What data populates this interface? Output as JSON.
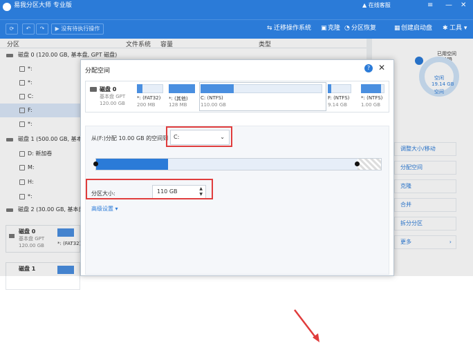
{
  "app": {
    "title": "易我分区大师 专业版",
    "service_label": "在线客服",
    "window_controls": {
      "menu": "≡",
      "minimize": "—",
      "close": "✕"
    }
  },
  "toolbar": {
    "refresh_icon": "refresh-icon",
    "undo_icon": "undo-icon",
    "redo_icon": "redo-icon",
    "pending_label": "没有待执行操作",
    "items": [
      {
        "label": "迁移操作系统",
        "icon": "migrate-icon"
      },
      {
        "label": "克隆",
        "icon": "clone-icon"
      },
      {
        "label": "分区恢复",
        "icon": "recovery-icon"
      },
      {
        "label": "创建启动盘",
        "icon": "bootable-icon"
      },
      {
        "label": "工具 ▾",
        "icon": "tools-icon"
      }
    ]
  },
  "columns": {
    "partition": "分区",
    "filesystem": "文件系统",
    "capacity": "容量",
    "type": "类型"
  },
  "tree": [
    {
      "label": "磁盘 0 (120.00 GB, 基本盘, GPT 磁盘)",
      "kind": "disk"
    },
    {
      "label": "*:",
      "kind": "part"
    },
    {
      "label": "*:",
      "kind": "part"
    },
    {
      "label": "C:",
      "kind": "part"
    },
    {
      "label": "F:",
      "kind": "part",
      "selected": true
    },
    {
      "label": "*:",
      "kind": "part"
    },
    {
      "label": "磁盘 1 (500.00 GB, 基本盘, GP",
      "kind": "disk"
    },
    {
      "label": "D: 新加卷",
      "kind": "part"
    },
    {
      "label": "M:",
      "kind": "part"
    },
    {
      "label": "H:",
      "kind": "part"
    },
    {
      "label": "*:",
      "kind": "part"
    },
    {
      "label": "磁盘 2 (30.00 GB, 基本盘, GP",
      "kind": "disk"
    }
  ],
  "cards": [
    {
      "name": "磁盘 0",
      "type": "基本盘 GPT",
      "size": "120.00 GB",
      "seg": "*: (FAT32)"
    },
    {
      "name": "磁盘 1",
      "type": "",
      "size": ""
    }
  ],
  "right_panel": {
    "used_label": "已用空间",
    "used_value": "93 MB",
    "free_label": "空闲",
    "free_value": "19.14 GB",
    "free_sub": "空间",
    "actions": [
      "调整大小/移动",
      "分配空间",
      "克隆",
      "合并",
      "拆分分区",
      "更多"
    ]
  },
  "dialog": {
    "title": "分配空间",
    "help_icon": "?",
    "close_icon": "✕",
    "disk": {
      "name": "磁盘 0",
      "type": "基本盘 GPT",
      "size": "120.00 GB"
    },
    "segments": [
      {
        "name": "*: (FAT32)",
        "size": "200 MB",
        "fill": 0.2
      },
      {
        "name": "*: (其他)",
        "size": "128 MB",
        "fill": 1.0
      },
      {
        "name": "C: (NTFS)",
        "size": "110.00 GB",
        "fill": 0.27,
        "selected": true
      },
      {
        "name": "F: (NTFS)",
        "size": "9.14 GB",
        "fill": 0.15
      },
      {
        "name": "*: (NTFS)",
        "size": "1.00 GB",
        "fill": 0.85
      }
    ],
    "from_label": "从(F:)分配 10.00 GB 的空间到",
    "target_value": "C:",
    "size_label": "分区大小:",
    "size_value": "110 GB",
    "advanced_label": "高级设置 ▾",
    "slider": {
      "allocated_fraction": 0.25
    }
  },
  "colors": {
    "accent": "#2b7bd8",
    "highlight": "#e03c3c"
  }
}
